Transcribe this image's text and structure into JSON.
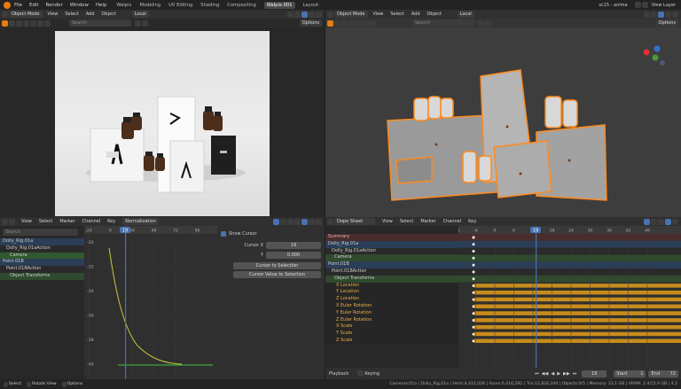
{
  "topbar": {
    "menu": [
      "File",
      "Edit",
      "Render",
      "Window",
      "Help"
    ],
    "tabs": [
      "Walpix",
      "Modeling",
      "UV Editing",
      "Shading",
      "Compositing",
      "Walpix.001",
      "Layout"
    ],
    "active_tab": "Walpix.001",
    "scene_name": "sc15 - anima",
    "view_layer": "View Layer"
  },
  "left_view": {
    "mode": "Object Mode",
    "menus": [
      "View",
      "Select",
      "Add",
      "Object"
    ],
    "orientation": "Local",
    "search_placeholder": "Search",
    "options": "Options"
  },
  "right_view": {
    "mode": "Object Mode",
    "menus": [
      "View",
      "Select",
      "Add",
      "Object"
    ],
    "orientation": "Local",
    "search_placeholder": "Search",
    "options": "Options"
  },
  "graph_editor": {
    "menus": [
      "View",
      "Select",
      "Marker",
      "Channel",
      "Key"
    ],
    "normalize": "Normalization",
    "search_placeholder": "Search",
    "channels": [
      {
        "label": "Dolly_Rig.01a",
        "level": 0,
        "type": "object"
      },
      {
        "label": "Dolly_Rig.01aAction",
        "level": 1,
        "type": "action"
      },
      {
        "label": "Camera",
        "level": 2,
        "type": "group",
        "selected": true
      },
      {
        "label": "Point.01B",
        "level": 0,
        "type": "object"
      },
      {
        "label": "Point.01BAction",
        "level": 1,
        "type": "action"
      },
      {
        "label": "Object Transforms",
        "level": 2,
        "type": "group"
      }
    ],
    "frame_ticks": [
      "-24",
      "0",
      "24",
      "48",
      "72",
      "96"
    ],
    "current_frame": "19",
    "value_ticks": [
      "-30",
      "-32",
      "-34",
      "-36",
      "-38",
      "-40"
    ],
    "view_panel": {
      "show_cursor": "Show Cursor",
      "cursor_x_label": "Cursor X",
      "cursor_x": "19",
      "y_label": "Y",
      "y_value": "0.000",
      "cursor_to_selection": "Cursor to Selection",
      "cursor_value_to_selection": "Cursor Value to Selection"
    }
  },
  "dope_sheet": {
    "mode": "Dope Sheet",
    "menus": [
      "View",
      "Select",
      "Marker",
      "Channel",
      "Key"
    ],
    "frame_ticks": [
      "-12",
      "-6",
      "0",
      "6",
      "12",
      "18",
      "24",
      "30",
      "36",
      "42",
      "48"
    ],
    "current_frame": "19",
    "summary": "Summary",
    "channels": [
      {
        "label": "Dolly_Rig.01a",
        "type": "object"
      },
      {
        "label": "Dolly_Rig.01aAction",
        "type": "action"
      },
      {
        "label": "Camera",
        "type": "group"
      },
      {
        "label": "Point.01B",
        "type": "object"
      },
      {
        "label": "Point.01BAction",
        "type": "action"
      },
      {
        "label": "Object Transforms",
        "type": "group"
      },
      {
        "label": "X Location",
        "type": "fcurve"
      },
      {
        "label": "Y Location",
        "type": "fcurve"
      },
      {
        "label": "Z Location",
        "type": "fcurve"
      },
      {
        "label": "X Euler Rotation",
        "type": "fcurve"
      },
      {
        "label": "Y Euler Rotation",
        "type": "fcurve"
      },
      {
        "label": "Z Euler Rotation",
        "type": "fcurve"
      },
      {
        "label": "X Scale",
        "type": "fcurve"
      },
      {
        "label": "Y Scale",
        "type": "fcurve"
      },
      {
        "label": "Z Scale",
        "type": "fcurve"
      }
    ]
  },
  "playback": {
    "playback": "Playback",
    "keying": "Keying",
    "current": "19",
    "start_label": "Start",
    "start": "1",
    "end_label": "End",
    "end": "72"
  },
  "status": {
    "left": [
      "Select",
      "Rotate View",
      "Options"
    ],
    "right": "Cameras:01a | Dolly_Rig.01a | Verts:4,415,026 | Faces:6,416,292 | Tris:12,826,340 | Objects:0/5 | Memory: 23.1 GB | VRAM: 2.4/15.9 GB | 4.2"
  },
  "colors": {
    "selection": "#ff8a1d",
    "playhead": "#4772b3",
    "keyframe_bar": "#c78c1c"
  }
}
